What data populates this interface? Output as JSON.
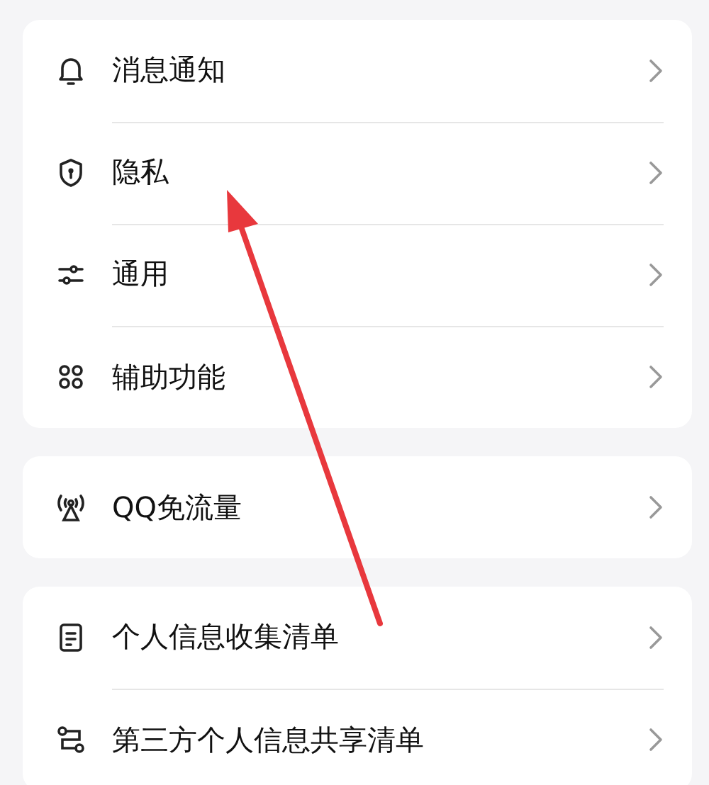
{
  "groups": [
    {
      "items": [
        {
          "label": "消息通知"
        },
        {
          "label": "隐私"
        },
        {
          "label": "通用"
        },
        {
          "label": "辅助功能"
        }
      ]
    },
    {
      "items": [
        {
          "label": "QQ免流量"
        }
      ]
    },
    {
      "items": [
        {
          "label": "个人信息收集清单"
        },
        {
          "label": "第三方个人信息共享清单"
        }
      ]
    }
  ]
}
